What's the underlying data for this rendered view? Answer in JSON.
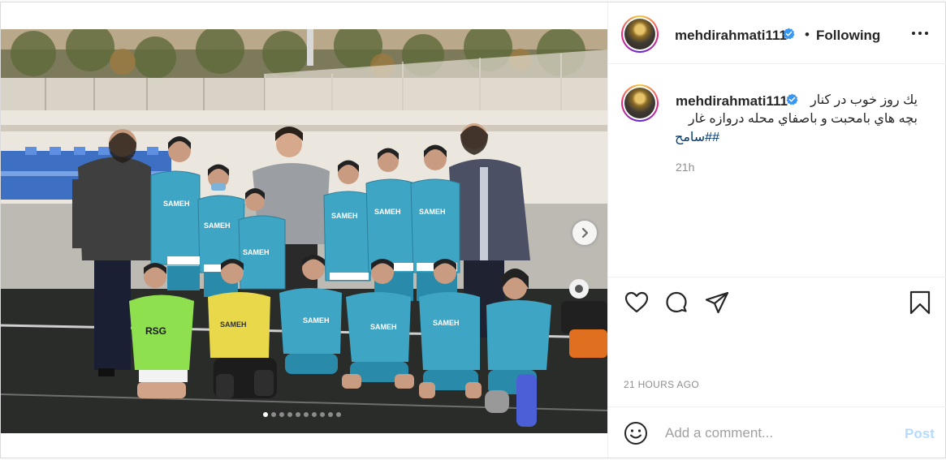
{
  "account": {
    "username": "mehdirahmati111",
    "verified": true,
    "follow_status": "Following"
  },
  "header": {
    "separator": "•",
    "more_icon": "more-options-icon"
  },
  "caption": {
    "username": "mehdirahmati111",
    "line1": "يك روز خوب در كنار",
    "line2": "بچه هاي بامحبت و باصفاي محله دروازه غار",
    "hashtag": "##سامح",
    "time": "21h"
  },
  "photo": {
    "carousel_count": 10,
    "active_index": 0,
    "next_icon": "chevron-right-icon",
    "jersey_text": "SAMEH",
    "shirt_text": "RSG"
  },
  "actions": {
    "like_icon": "heart-icon",
    "comment_icon": "comment-icon",
    "share_icon": "paper-plane-icon",
    "save_icon": "bookmark-icon"
  },
  "timestamp": "21 HOURS AGO",
  "comment": {
    "emoji_icon": "smiley-icon",
    "placeholder": "Add a comment...",
    "post_label": "Post"
  },
  "colors": {
    "link": "#00376b",
    "post_button_disabled": "#b3dbff",
    "verified_blue": "#3897f0",
    "jersey_teal": "#3ea6c4"
  }
}
